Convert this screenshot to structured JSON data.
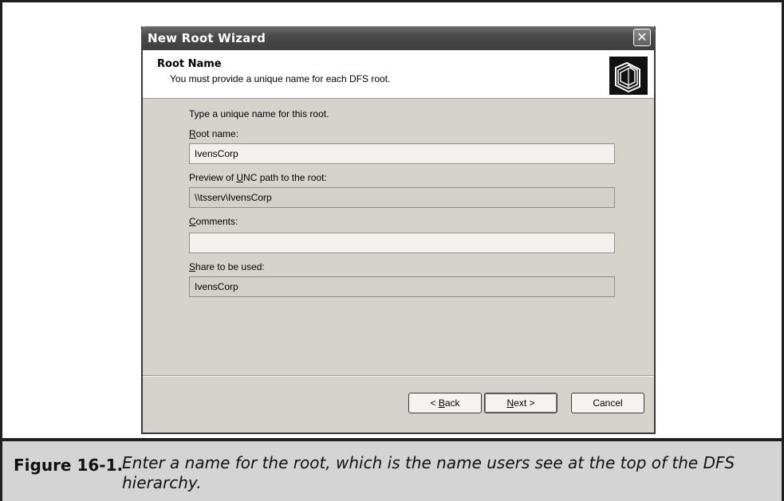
{
  "dialog": {
    "title": "New Root Wizard",
    "close_glyph": "✕",
    "header": {
      "title": "Root Name",
      "subtitle": "You must provide a unique name for each DFS root.",
      "icon": "folders-icon"
    },
    "instruction": "Type a unique name for this root.",
    "root_name": {
      "label_accel": "R",
      "label_rest": "oot name:",
      "value": "IvensCorp"
    },
    "unc_path": {
      "label_pre": "Preview of ",
      "label_accel": "U",
      "label_rest": "NC path to the root:",
      "value": "\\\\tsserv\\IvensCorp"
    },
    "comments": {
      "label_accel": "C",
      "label_rest": "omments:",
      "value": ""
    },
    "share": {
      "label_accel": "S",
      "label_rest": "hare to be used:",
      "value": "IvensCorp"
    },
    "buttons": {
      "back_pre": "< ",
      "back_accel": "B",
      "back_rest": "ack",
      "next_accel": "N",
      "next_rest": "ext >",
      "cancel": "Cancel"
    }
  },
  "caption": {
    "label": "Figure 16-1.",
    "text": "Enter a name for the root, which is the name users see at the top of the DFS hierarchy."
  }
}
